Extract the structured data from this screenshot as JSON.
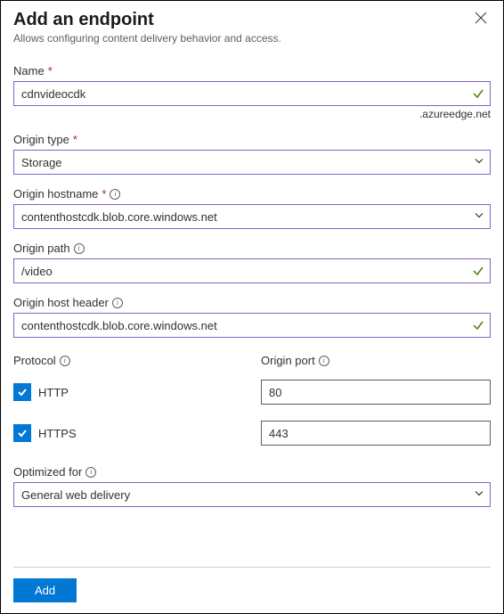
{
  "header": {
    "title": "Add an endpoint",
    "subtitle": "Allows configuring content delivery behavior and access."
  },
  "fields": {
    "name": {
      "label": "Name",
      "value": "cdnvideocdk",
      "suffix": ".azureedge.net"
    },
    "origin_type": {
      "label": "Origin type",
      "value": "Storage"
    },
    "origin_hostname": {
      "label": "Origin hostname",
      "value": "contenthostcdk.blob.core.windows.net"
    },
    "origin_path": {
      "label": "Origin path",
      "value": "/video"
    },
    "origin_host_header": {
      "label": "Origin host header",
      "value": "contenthostcdk.blob.core.windows.net"
    },
    "protocol": {
      "label": "Protocol"
    },
    "origin_port": {
      "label": "Origin port"
    },
    "http": {
      "label": "HTTP",
      "port": "80"
    },
    "https": {
      "label": "HTTPS",
      "port": "443"
    },
    "optimized_for": {
      "label": "Optimized for",
      "value": "General web delivery"
    }
  },
  "footer": {
    "add_label": "Add"
  },
  "colors": {
    "accent": "#0078d4",
    "input_border": "#8661c5",
    "valid": "#498205"
  }
}
